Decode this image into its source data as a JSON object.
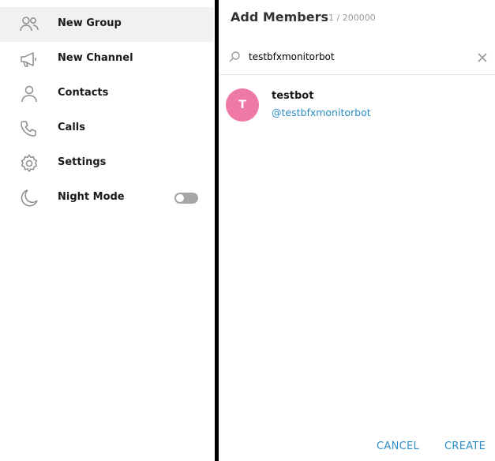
{
  "sidebar": {
    "items": [
      {
        "label": "New Group",
        "icon": "group-icon"
      },
      {
        "label": "New Channel",
        "icon": "megaphone-icon"
      },
      {
        "label": "Contacts",
        "icon": "person-icon"
      },
      {
        "label": "Calls",
        "icon": "phone-icon"
      },
      {
        "label": "Settings",
        "icon": "gear-icon"
      },
      {
        "label": "Night Mode",
        "icon": "moon-icon",
        "toggle_on": false
      }
    ]
  },
  "dialog": {
    "title": "Add Members",
    "count": "1 / 200000",
    "search": {
      "value": "testbfxmonitorbot"
    },
    "results": [
      {
        "initial": "T",
        "name": "testbot",
        "username": "@testbfxmonitorbot",
        "avatar_color": "#ee78a6"
      }
    ],
    "buttons": {
      "cancel": "CANCEL",
      "create": "CREATE"
    }
  },
  "colors": {
    "accent": "#2d8dc8",
    "active_bg": "#f1f1f1",
    "icon": "#8d8d8d"
  }
}
